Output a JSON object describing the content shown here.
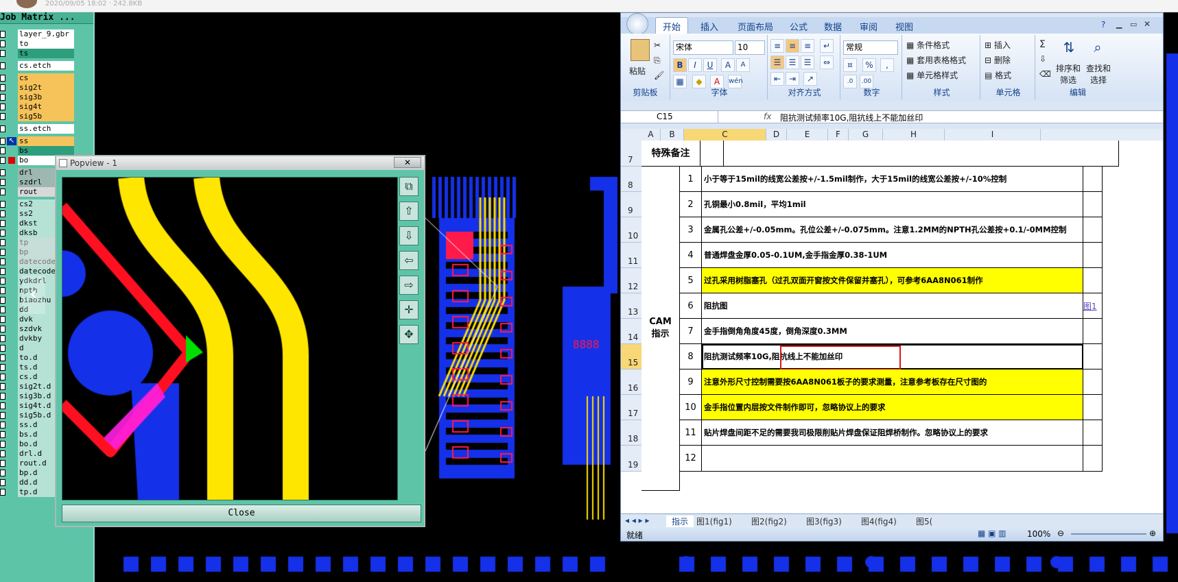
{
  "top": {
    "meta": "2020/09/05 18:02 · 242.8KB"
  },
  "job_matrix": {
    "title": "Job Matrix ...",
    "layers": [
      "layer_9.gbr",
      "to",
      "ts",
      "cs.etch",
      "cs",
      "sig2t",
      "sig3b",
      "sig4t",
      "sig5b",
      "ss.etch",
      "ss",
      "bs",
      "bo",
      "drl",
      "szdrl",
      "rout",
      "cs2",
      "ss2",
      "dkst",
      "dksb",
      "tp",
      "bp",
      "datecode",
      "datecode",
      "ydkdrl",
      "npth",
      "biaozhu",
      "dd",
      "dvk",
      "szdvk",
      "dvkby",
      "d",
      "to.d",
      "ts.d",
      "cs.d",
      "sig2t.d",
      "sig3b.d",
      "sig4t.d",
      "sig5b.d",
      "ss.d",
      "bs.d",
      "bo.d",
      "drl.d",
      "rout.d",
      "bp.d",
      "dd.d",
      "tp.d"
    ]
  },
  "popview": {
    "title": "Popview - 1",
    "close_x": "✕",
    "close": "Close"
  },
  "nav": {
    "prev": "‹",
    "next": "›"
  },
  "excel": {
    "tabs": [
      "开始",
      "插入",
      "页面布局",
      "公式",
      "数据",
      "审阅",
      "视图"
    ],
    "clipboard": {
      "paste": "粘贴",
      "label": "剪贴板"
    },
    "font": {
      "name": "宋体",
      "size": "10",
      "label": "字体",
      "bold": "B",
      "italic": "I",
      "underline": "U",
      "grow": "A",
      "shrink": "A",
      "font_color": "A"
    },
    "align": {
      "label": "对齐方式"
    },
    "number": {
      "format": "常规",
      "label": "数字",
      "percent": "%"
    },
    "styles": {
      "cond": "条件格式",
      "table": "套用表格格式",
      "cell": "单元格样式",
      "label": "样式"
    },
    "cells": {
      "insert": "插入",
      "delete": "删除",
      "format": "格式",
      "label": "单元格"
    },
    "edit": {
      "sigma": "Σ",
      "sort": "排序和筛选",
      "find": "查找和选择",
      "label": "编辑"
    },
    "namebox": "C15",
    "fx": "fx",
    "formula": "阻抗测试频率10G,阻抗线上不能加丝印",
    "cols": [
      "A",
      "B",
      "C",
      "D",
      "E",
      "F",
      "G",
      "H",
      "I"
    ],
    "row7": "特殊备注",
    "cam": "CAM\n指示",
    "rows": [
      {
        "r": "8",
        "n": "1",
        "t": "小于等于15mil的线宽公差按+/-1.5mil制作，大于15mil的线宽公差按+/-10%控制",
        "y": false
      },
      {
        "r": "9",
        "n": "2",
        "t": "孔铜最小0.8mil，平均1mil",
        "y": false
      },
      {
        "r": "10",
        "n": "3",
        "t": "金属孔公差+/-0.05mm。孔位公差+/-0.075mm。注意1.2MM的NPTH孔公差按+0.1/-0MM控制",
        "y": false
      },
      {
        "r": "11",
        "n": "4",
        "t": "普通焊盘金厚0.05-0.1UM,金手指金厚0.38-1UM",
        "y": false
      },
      {
        "r": "12",
        "n": "5",
        "t": "过孔采用树脂塞孔（过孔双面开窗按文件保留并塞孔），可参考6AA8N061制作",
        "y": true
      },
      {
        "r": "13",
        "n": "6",
        "t": "阻抗图",
        "y": false
      },
      {
        "r": "14",
        "n": "7",
        "t": "金手指倒角角度45度，倒角深度0.3MM",
        "y": false
      },
      {
        "r": "15",
        "n": "8",
        "t": "阻抗测试频率10G,阻抗线上不能加丝印",
        "y": false
      },
      {
        "r": "16",
        "n": "9",
        "t": "注意外形尺寸控制需要按6AA8N061板子的要求测量，注意参考板存在尺寸图的",
        "y": true
      },
      {
        "r": "17",
        "n": "10",
        "t": "金手指位置内层按文件制作即可，忽略协议上的要求",
        "y": true
      },
      {
        "r": "18",
        "n": "11",
        "t": "贴片焊盘间距不足的需要我司极限削贴片焊盘保证阻焊桥制作。忽略协议上的要求",
        "y": false
      },
      {
        "r": "19",
        "n": "12",
        "t": "",
        "y": false
      }
    ],
    "link": "图1",
    "sheets": [
      "指示",
      "图1(fig1)",
      "图2(fig2)",
      "图3(fig3)",
      "图4(fig4)",
      "图5("
    ],
    "status": "就绪",
    "zoom": "100%"
  }
}
